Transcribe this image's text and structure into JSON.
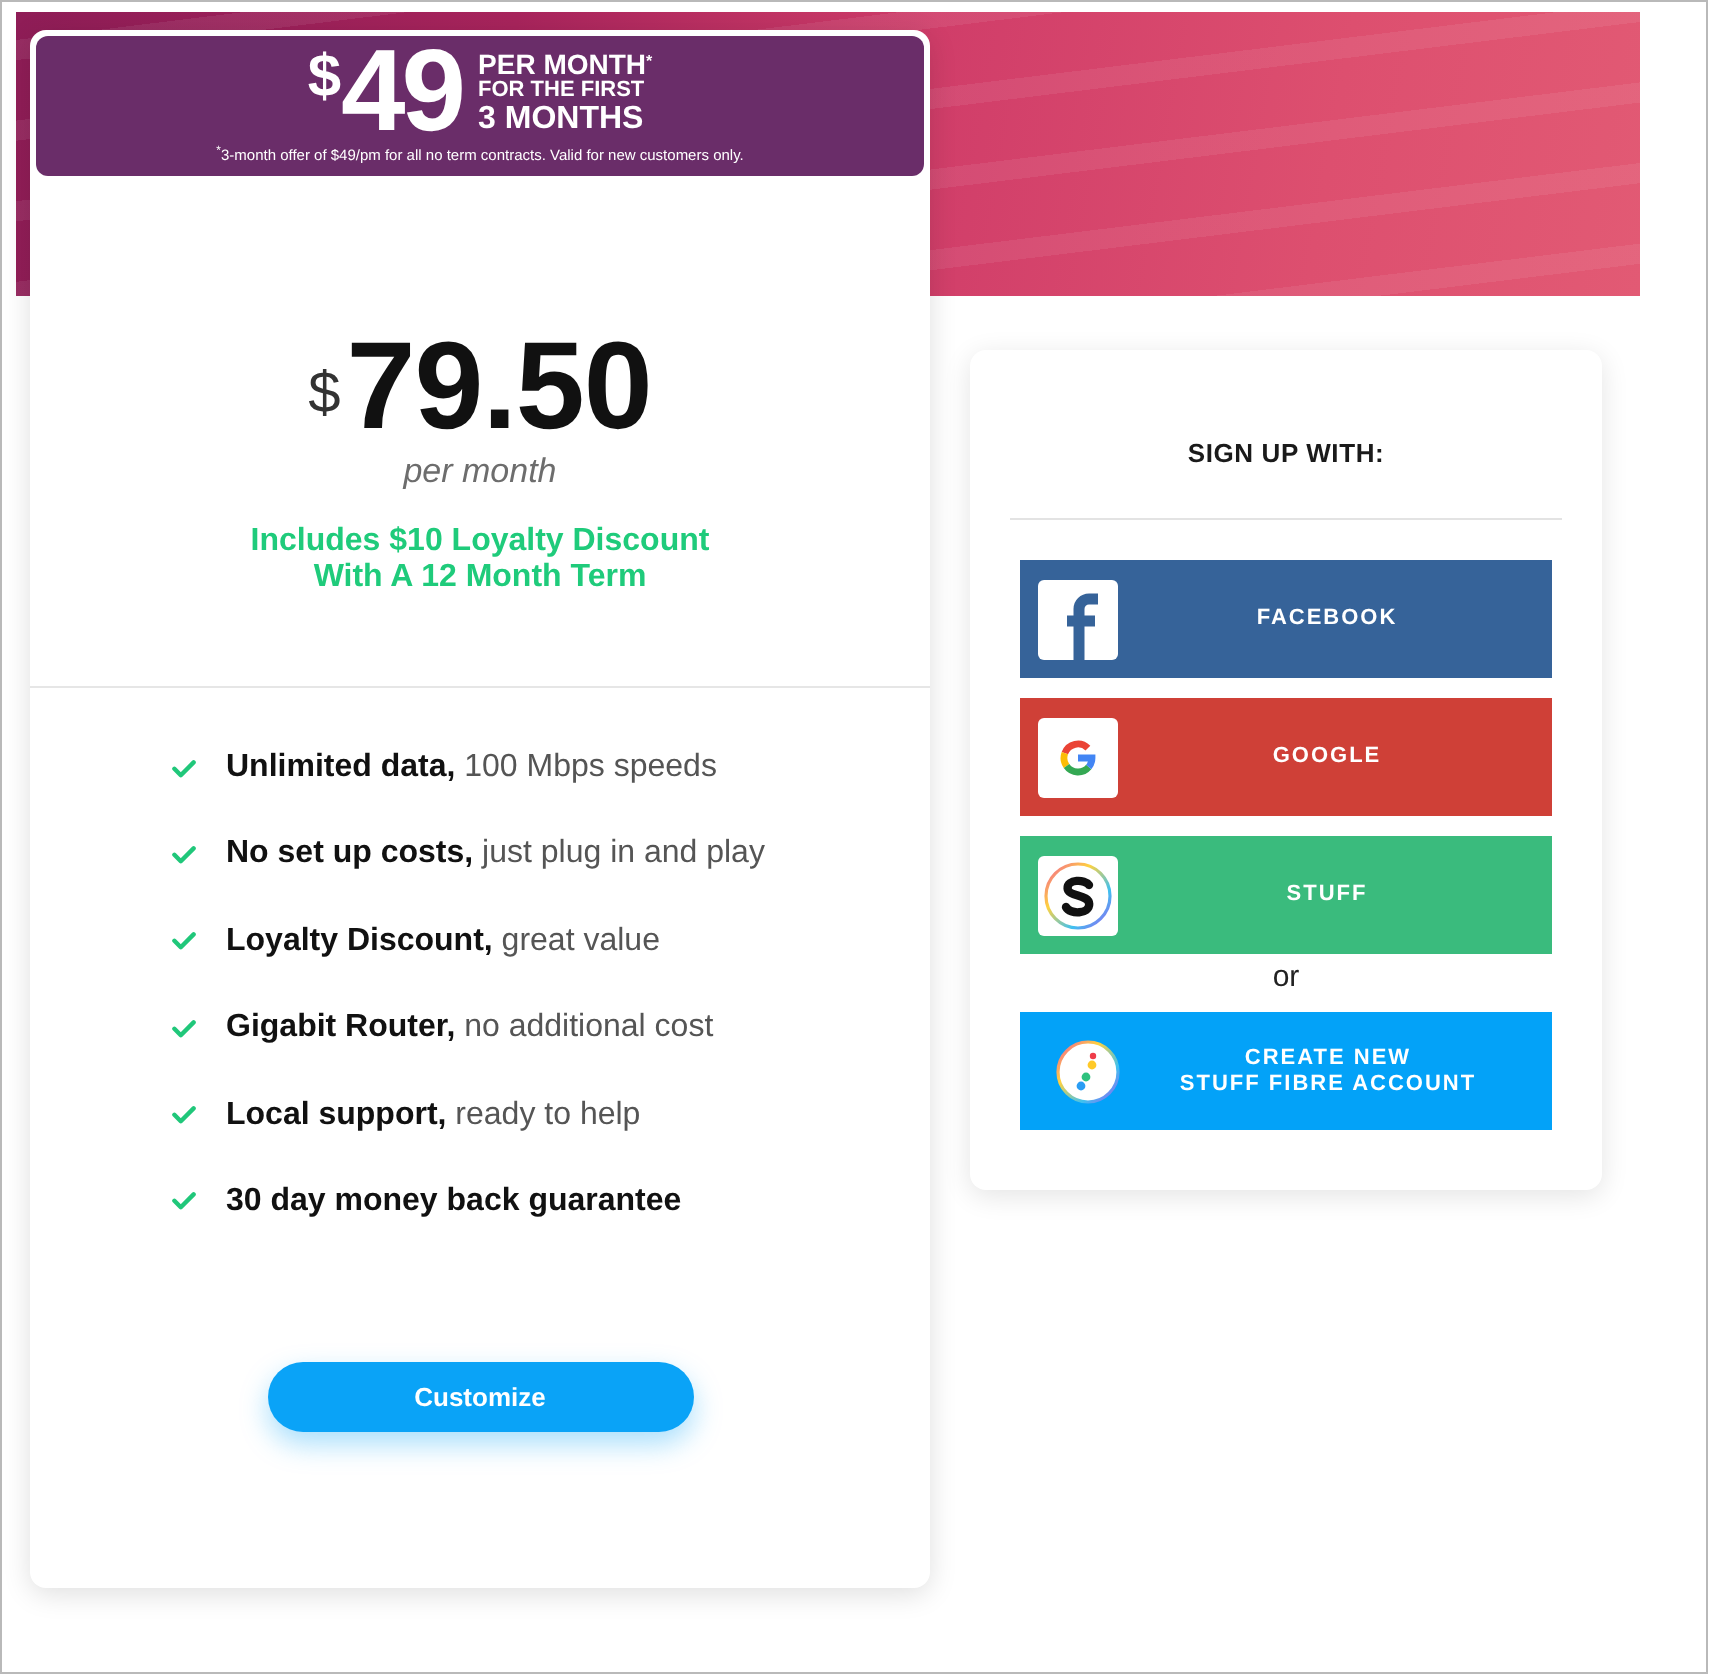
{
  "promo": {
    "currency": "$",
    "amount": "49",
    "headline": [
      "PER MONTH$^{*}$",
      "FOR THE FIRST",
      "3 MONTHS"
    ],
    "footnote": "$^{*}$3-month offer of $49/pm for all no term contracts. Valid for new customers only."
  },
  "plan": {
    "currency": "$",
    "price": "79.50",
    "period": "per month",
    "discount_note": [
      "Includes $10 Loyalty Discount",
      "With A 12 Month Term"
    ]
  },
  "features": [
    {
      "title": "Unlimited data,",
      "detail": "100 Mbps speeds"
    },
    {
      "title": "No set up costs,",
      "detail": "just plug in and play"
    },
    {
      "title": "Loyalty Discount,",
      "detail": "great value"
    },
    {
      "title": "Gigabit Router,",
      "detail": "no additional cost"
    },
    {
      "title": "Local support,",
      "detail": "ready to help"
    },
    {
      "title": "30 day money back guarantee"
    }
  ],
  "customize_button": {
    "label": "Customize"
  },
  "signup": {
    "title": "SIGN UP WITH:",
    "providers": [
      {
        "kind": "facebook",
        "label": "FACEBOOK",
        "color": "#366399"
      },
      {
        "kind": "google",
        "label": "GOOGLE",
        "color": "#cf4037"
      },
      {
        "kind": "stuff",
        "label": "STUFF",
        "color": "#3abb7d"
      }
    ],
    "separator": "or",
    "create_button": {
      "label": [
        "CREATE NEW",
        "STUFF FIBRE ACCOUNT"
      ]
    }
  }
}
